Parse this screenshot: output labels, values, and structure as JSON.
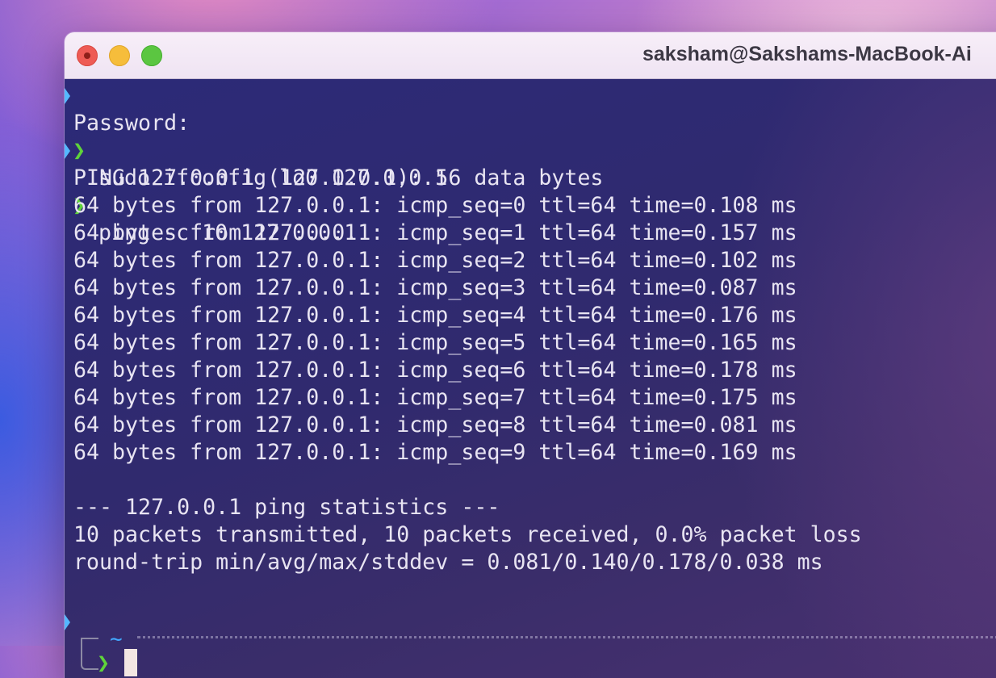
{
  "window": {
    "title": "saksham@Sakshams-MacBook-Ai",
    "controls": [
      "close",
      "minimize",
      "zoom"
    ]
  },
  "prompt": {
    "symbol": "❯",
    "directory": "~"
  },
  "terminal": {
    "commands": [
      "sudo ifconfig lo0 127.0.0.1",
      "ping -c 10 127.0.0.1"
    ],
    "password_prompt": "Password:",
    "ping_header": "PING 127.0.0.1 (127.0.0.1): 56 data bytes",
    "ping_replies": [
      "64 bytes from 127.0.0.1: icmp_seq=0 ttl=64 time=0.108 ms",
      "64 bytes from 127.0.0.1: icmp_seq=1 ttl=64 time=0.157 ms",
      "64 bytes from 127.0.0.1: icmp_seq=2 ttl=64 time=0.102 ms",
      "64 bytes from 127.0.0.1: icmp_seq=3 ttl=64 time=0.087 ms",
      "64 bytes from 127.0.0.1: icmp_seq=4 ttl=64 time=0.176 ms",
      "64 bytes from 127.0.0.1: icmp_seq=5 ttl=64 time=0.165 ms",
      "64 bytes from 127.0.0.1: icmp_seq=6 ttl=64 time=0.178 ms",
      "64 bytes from 127.0.0.1: icmp_seq=7 ttl=64 time=0.175 ms",
      "64 bytes from 127.0.0.1: icmp_seq=8 ttl=64 time=0.081 ms",
      "64 bytes from 127.0.0.1: icmp_seq=9 ttl=64 time=0.169 ms"
    ],
    "stats_header": "--- 127.0.0.1 ping statistics ---",
    "stats_summary": "10 packets transmitted, 10 packets received, 0.0% packet loss",
    "stats_rtt": "round-trip min/avg/max/stddev = 0.081/0.140/0.178/0.038 ms"
  },
  "colors": {
    "prompt_chevron": "#5fd33a",
    "prompt_marker": "#55b8ff",
    "directory": "#42a8ff",
    "text": "#e8e4f2",
    "cursor": "#f3e6e2"
  }
}
